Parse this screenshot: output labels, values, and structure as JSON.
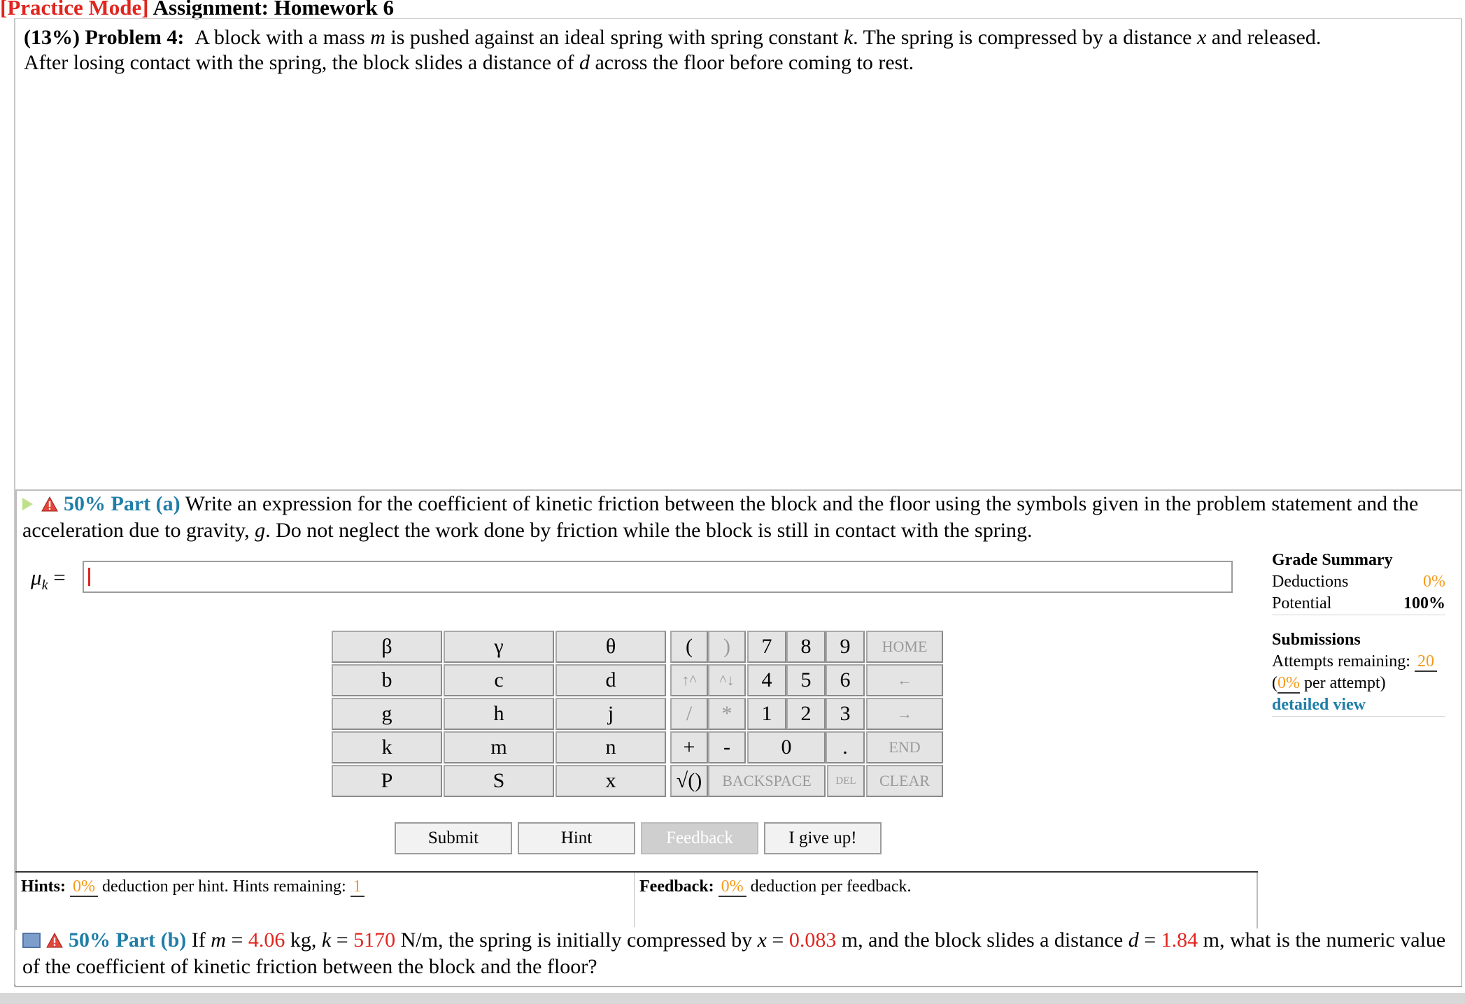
{
  "header": {
    "mode": "[Practice Mode]",
    "assignment": " Assignment: Homework 6"
  },
  "problem": {
    "weight": "(13%)",
    "label": "Problem 4:",
    "text_1": "A block with a mass ",
    "m": "m",
    "text_2": " is pushed against an ideal spring with spring constant ",
    "k": "k",
    "text_3": ". The spring is compressed by a distance ",
    "x": "x",
    "text_4": " and released.",
    "text_5": "After losing contact with the spring, the block slides a distance of ",
    "d": "d",
    "text_6": " across the floor before coming to rest."
  },
  "part_a": {
    "percent": "50% Part (a)",
    "text_1": " Write an expression for the coefficient of kinetic friction between the block and the floor using the symbols given in the problem statement and the acceleration due to gravity, ",
    "g": "g",
    "text_2": ". Do not neglect the work done by friction while the block is still in contact with the spring.",
    "answer_label": "μ",
    "answer_sub": "k",
    "answer_eq": " =",
    "answer_value": ""
  },
  "grade_summary": {
    "title": "Grade Summary",
    "deductions_label": "Deductions",
    "deductions_value": "0%",
    "potential_label": "Potential",
    "potential_value": "100%",
    "submissions_title": "Submissions",
    "attempts_label": "Attempts remaining: ",
    "attempts_value": "20",
    "per_attempt_open": "(",
    "per_attempt_value": "0%",
    "per_attempt_label": " per attempt)",
    "detailed_view": "detailed view"
  },
  "keypad": {
    "symbols": [
      [
        "β",
        "γ",
        "θ"
      ],
      [
        "b",
        "c",
        "d"
      ],
      [
        "g",
        "h",
        "j"
      ],
      [
        "k",
        "m",
        "n"
      ],
      [
        "P",
        "S",
        "x"
      ]
    ],
    "paren_open": "(",
    "paren_close": ")",
    "up_arrow": "↑^",
    "down_arrow": "^↓",
    "divide": "/",
    "multiply": "*",
    "plus": "+",
    "minus": "-",
    "sqrt": "√()",
    "backspace": "BACKSPACE",
    "del": "DEL",
    "digits": [
      [
        "7",
        "8",
        "9"
      ],
      [
        "4",
        "5",
        "6"
      ],
      [
        "1",
        "2",
        "3"
      ]
    ],
    "zero": "0",
    "dot": ".",
    "home": "HOME",
    "left": "←",
    "right": "→",
    "end": "END",
    "clear": "CLEAR"
  },
  "buttons": {
    "submit": "Submit",
    "hint": "Hint",
    "feedback": "Feedback",
    "give_up": "I give up!"
  },
  "hints": {
    "label": "Hints: ",
    "value": "0%",
    "text": " deduction per hint. Hints remaining: ",
    "remaining": "1"
  },
  "feedback": {
    "label": "Feedback: ",
    "value": "0%",
    "text": " deduction per feedback."
  },
  "part_b": {
    "percent": "50% Part (b)",
    "t1": " If ",
    "m": "m",
    "eq1": " = ",
    "m_val": "4.06",
    "u1": " kg, ",
    "k": "k",
    "eq2": " = ",
    "k_val": "5170",
    "u2": " N/m, the spring is initially compressed by ",
    "x": "x",
    "eq3": " = ",
    "x_val": "0.083",
    "u3": " m, and the block slides a distance ",
    "d": "d",
    "eq4": " = ",
    "d_val": "1.84",
    "u4": " m, what is the numeric value of the coefficient of kinetic friction between the block and the floor?"
  },
  "colors": {
    "accent_blue": "#1f7ea8",
    "mode_red": "#e0261e",
    "orange": "#f59a1a"
  }
}
